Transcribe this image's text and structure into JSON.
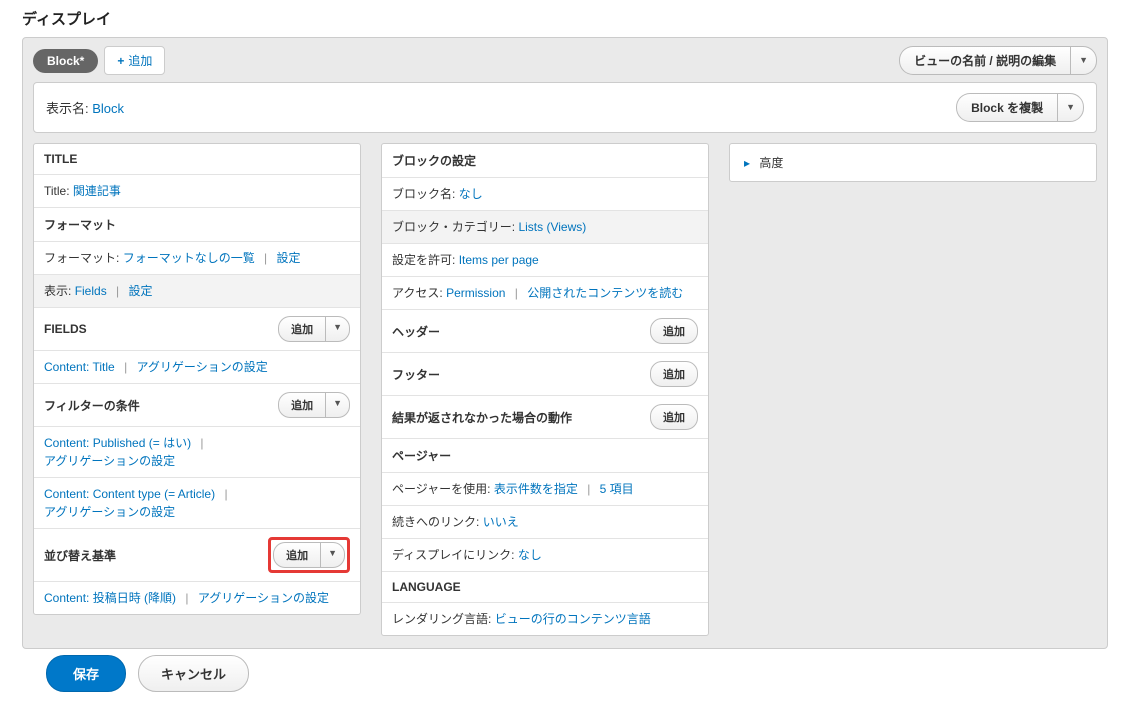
{
  "page_heading": "ディスプレイ",
  "tabs": {
    "active": "Block*",
    "add_label": "追加"
  },
  "top_right": {
    "edit_label": "ビューの名前 / 説明の編集"
  },
  "display_name": {
    "label": "表示名:",
    "value": "Block",
    "clone_label": "Block を複製"
  },
  "col1": {
    "title_hd": "TITLE",
    "title_label": "Title:",
    "title_value": "関連記事",
    "format_hd": "フォーマット",
    "format_label": "フォーマット:",
    "format_value": "フォーマットなしの一覧",
    "settings": "設定",
    "show_label": "表示:",
    "show_value": "Fields",
    "fields_hd": "FIELDS",
    "add_small": "追加",
    "field_item": "Content: Title",
    "agg_settings": "アグリゲーションの設定",
    "filter_hd": "フィルターの条件",
    "filter1": "Content: Published (= はい)",
    "filter2": "Content: Content type (= Article)",
    "sort_hd": "並び替え基準",
    "sort_item": "Content: 投稿日時 (降順)"
  },
  "col2": {
    "block_hd": "ブロックの設定",
    "block_name_label": "ブロック名:",
    "block_name_value": "なし",
    "block_cat_label": "ブロック・カテゴリー:",
    "block_cat_value": "Lists (Views)",
    "allow_label": "設定を許可:",
    "allow_value": "Items per page",
    "access_label": "アクセス:",
    "access_value": "Permission",
    "access_extra": "公開されたコンテンツを読む",
    "header_hd": "ヘッダー",
    "footer_hd": "フッター",
    "noresult_hd": "結果が返されなかった場合の動作",
    "pager_hd": "ページャー",
    "pager_use_label": "ページャーを使用:",
    "pager_use_value": "表示件数を指定",
    "pager_items": "5 項目",
    "more_label": "続きへのリンク:",
    "more_value": "いいえ",
    "display_link_label": "ディスプレイにリンク:",
    "display_link_value": "なし",
    "lang_hd": "LANGUAGE",
    "lang_label": "レンダリング言語:",
    "lang_value": "ビューの行のコンテンツ言語",
    "add_small": "追加"
  },
  "col3": {
    "advanced": "高度"
  },
  "footer": {
    "save": "保存",
    "cancel": "キャンセル"
  }
}
